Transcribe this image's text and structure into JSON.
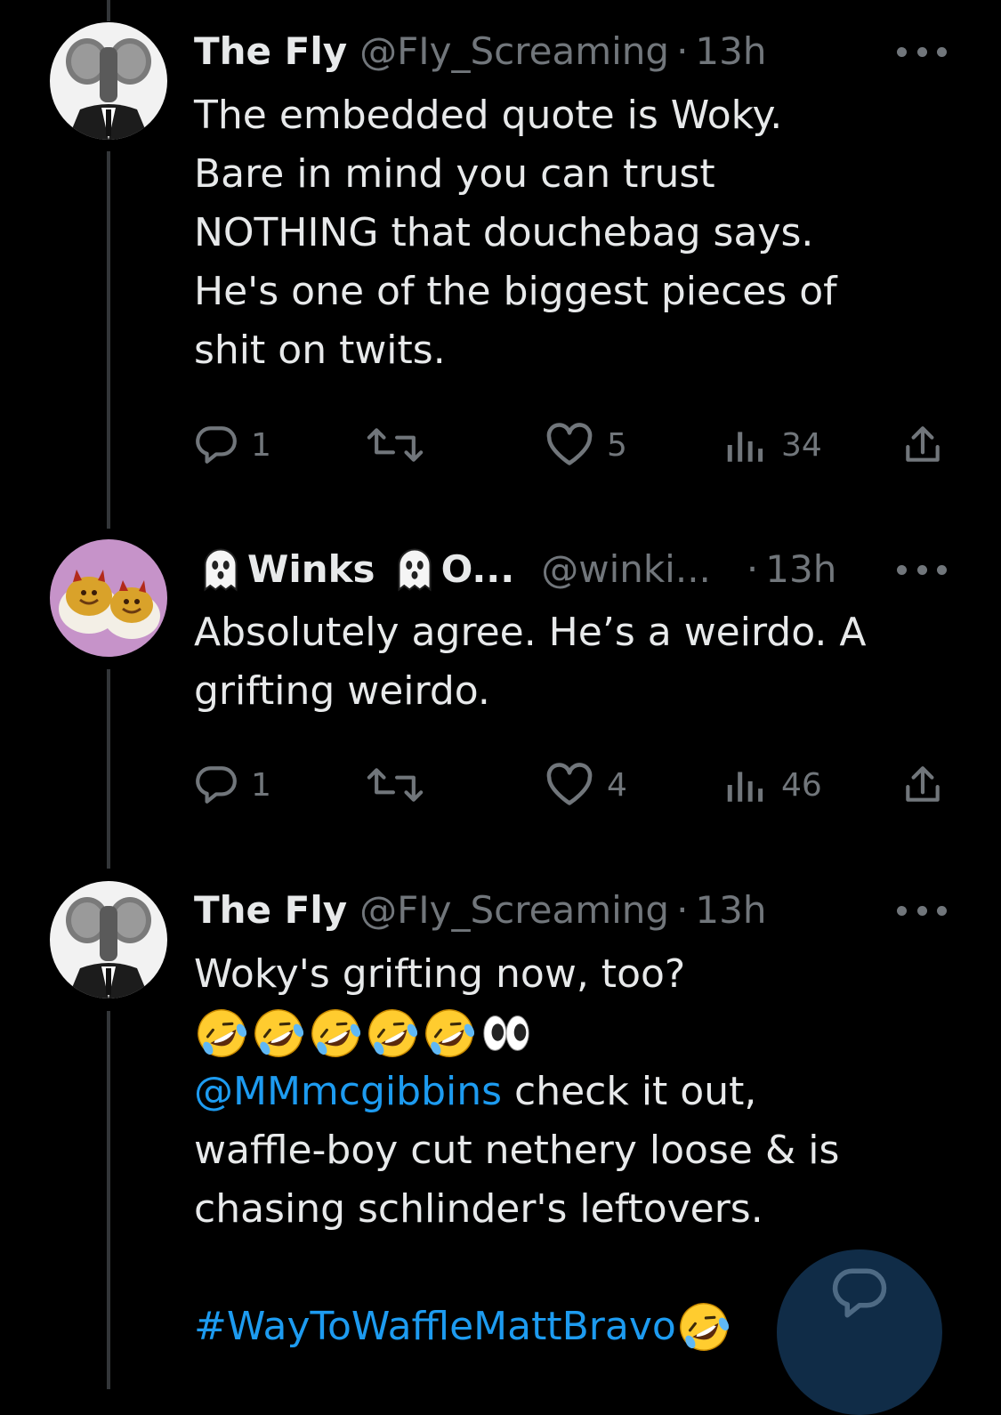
{
  "colors": {
    "background": "#000000",
    "primary_text": "#e7e9ea",
    "secondary_text": "#71767b",
    "link": "#1d9bf0",
    "thread_line": "#333639",
    "fab_background": "#102c47"
  },
  "tweets": [
    {
      "name": "The Fly",
      "handle": "@FIy_Screaming",
      "dot": "·",
      "time": "13h",
      "text": "The embedded quote is Woky.\nBare in mind you can trust\nNOTHING that douchebag says.\nHe's one of the biggest pieces of\nshit on twits.",
      "replies": "1",
      "likes": "5",
      "views": "34"
    },
    {
      "name": "Winks",
      "name_tail": "O...",
      "handle": "@winki...",
      "dot": "·",
      "time": "13h",
      "text": "Absolutely agree. He’s a weirdo. A\ngrifting weirdo.",
      "replies": "1",
      "likes": "4",
      "views": "46"
    },
    {
      "name": "The Fly",
      "handle": "@FIy_Screaming",
      "dot": "·",
      "time": "13h",
      "text_line1": "Woky's grifting now, too?",
      "mention": "@MMmcgibbins",
      "text_after_mention": " check it out,\nwaffle-boy cut nethery loose & is\nchasing schlinder's leftovers.",
      "hashtag": "#WayToWaffleMattBravo"
    }
  ],
  "icons": {
    "reply": "reply-bubble-icon",
    "retweet": "retweet-icon",
    "like": "heart-icon",
    "views": "views-bar-chart-icon",
    "share": "share-upload-icon",
    "more": "more-dots-icon",
    "compose": "compose-reply-icon",
    "emoji_rofl": "rolling-on-floor-laughing-emoji",
    "emoji_eyes": "eyes-emoji",
    "emoji_ghost": "ghost-emoji"
  }
}
